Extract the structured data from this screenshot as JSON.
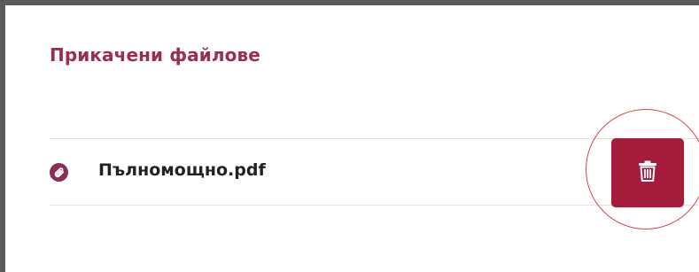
{
  "section": {
    "title": "Прикачени файлове"
  },
  "attachments": [
    {
      "name": "Пълномощно.pdf",
      "icon": "paperclip-icon",
      "delete_icon": "trash-icon"
    }
  ],
  "colors": {
    "title": "#9b2d55",
    "clip_icon_bg": "#8a2d57",
    "delete_button_bg": "#a51d3a",
    "highlight_circle": "#e0444b"
  }
}
